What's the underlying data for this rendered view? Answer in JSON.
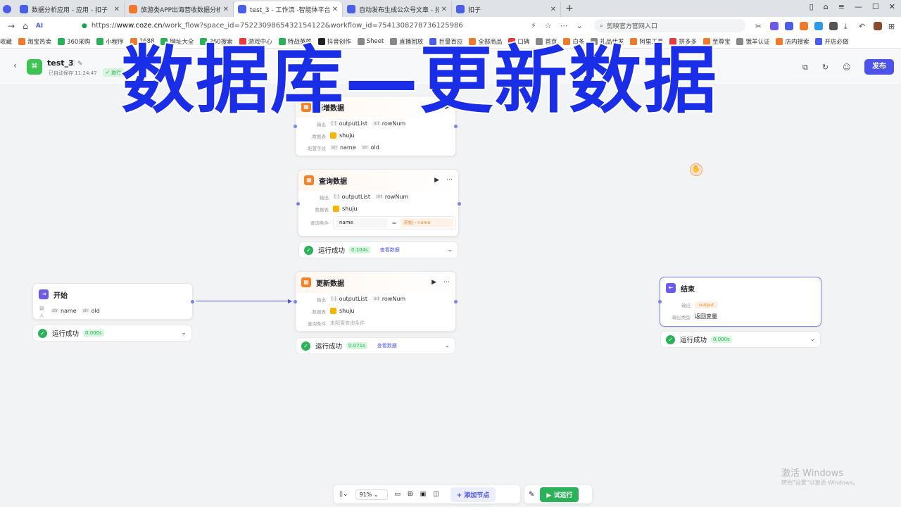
{
  "browser": {
    "tabs": [
      {
        "label": "数据分析应用 - 应用 - 扣子",
        "color": "#4a5ee8"
      },
      {
        "label": "旅游类APP出海营收数据分析报告",
        "color": "#f07a2b"
      },
      {
        "label": "test_3 - 工作流 -智能体平台",
        "color": "#4a5ee8",
        "active": true
      },
      {
        "label": "自动发布生成公众号文章 - 扣",
        "color": "#4a5ee8"
      },
      {
        "label": "扣子",
        "color": "#4a5ee8"
      }
    ],
    "new_tab": "+",
    "url_prefix": "https://",
    "url_host": "www.coze.cn",
    "url_path": "/work_flow?space_id=7522309865432154122&workflow_id=7541308278736125986",
    "search_placeholder": "剪映官方官网入口",
    "bookmarks": [
      {
        "label": "收藏",
        "color": ""
      },
      {
        "label": "淘宝热卖",
        "color": "#f07a2b"
      },
      {
        "label": "360采购",
        "color": "#2bb15a"
      },
      {
        "label": "小程序",
        "color": "#2bb15a"
      },
      {
        "label": "1688",
        "color": "#f07a2b"
      },
      {
        "label": "网址大全",
        "color": "#2bb15a"
      },
      {
        "label": "360搜索",
        "color": "#2bb15a"
      },
      {
        "label": "游戏中心",
        "color": "#e83a3a"
      },
      {
        "label": "特战英雄",
        "color": "#2bb15a"
      },
      {
        "label": "抖音创作",
        "color": "#222222"
      },
      {
        "label": "Sheet",
        "color": "#888888"
      },
      {
        "label": "直播回放",
        "color": "#888888"
      },
      {
        "label": "巨量百应",
        "color": "#4a5ee8"
      },
      {
        "label": "全部商品",
        "color": "#f07a2b"
      },
      {
        "label": "口碑",
        "color": "#e83a3a"
      },
      {
        "label": "首页",
        "color": "#888888"
      },
      {
        "label": "白条",
        "color": "#f07a2b"
      },
      {
        "label": "礼品代发",
        "color": "#888888"
      },
      {
        "label": "阿里工具",
        "color": "#f07a2b"
      },
      {
        "label": "拼多多",
        "color": "#e83a3a"
      },
      {
        "label": "至尊宝",
        "color": "#f07a2b"
      },
      {
        "label": "饿羊认证",
        "color": "#888888"
      },
      {
        "label": "店内搜索",
        "color": "#f07a2b"
      },
      {
        "label": "开店必做",
        "color": "#4a5ee8"
      }
    ]
  },
  "header": {
    "back": "‹",
    "app_name": "test_3",
    "app_icons": "ⓘ ✎",
    "autosave": "已自动保存 11:24:47",
    "run_badge": "✓ 运行",
    "publish_label": "发布"
  },
  "overlay_title": "数据库—更新数据",
  "nodes": {
    "top_db": {
      "title": "新增数据",
      "output_label": "输出",
      "outputs": [
        "outputList",
        "rowNum"
      ],
      "output_types": [
        "[·]",
        "int"
      ],
      "table_label": "数据表",
      "table": "shuju",
      "fields_label": "配置字段",
      "fields": [
        "name",
        "old"
      ],
      "field_types": [
        "str",
        "str"
      ]
    },
    "query": {
      "title": "查询数据",
      "output_label": "输出",
      "outputs": [
        "outputList",
        "rowNum"
      ],
      "output_types": [
        "[·]",
        "int"
      ],
      "table_label": "数据表",
      "table": "shuju",
      "cond_label": "查询条件",
      "cond_field": "name",
      "cond_op": "=",
      "cond_value": "开始 › name",
      "status": "运行成功",
      "time": "0.104s",
      "view": "查看数据"
    },
    "update": {
      "title": "更新数据",
      "output_label": "输出",
      "outputs": [
        "outputList",
        "rowNum"
      ],
      "output_types": [
        "[·]",
        "int"
      ],
      "table_label": "数据表",
      "table": "shuju",
      "cond_label": "查询条件",
      "cond_value": "未配置查询条件",
      "status": "运行成功",
      "time": "0.071s",
      "view": "查看数据"
    },
    "start": {
      "title": "开始",
      "input_label": "输入",
      "inputs": [
        "name",
        "old"
      ],
      "input_types": [
        "str",
        "str"
      ],
      "status": "运行成功",
      "time": "0.000s"
    },
    "end": {
      "title": "结束",
      "output_label": "输出",
      "output_value": "output",
      "type_label": "输出类型",
      "type_value": "返回变量",
      "status": "运行成功",
      "time": "0.000s"
    }
  },
  "toolbar": {
    "zoom": "91%",
    "add_node": "+ 添加节点",
    "test_run": "▶ 试运行"
  },
  "watermark": {
    "line1": "激活 Windows",
    "line2": "转到\"设置\"以激活 Windows。"
  },
  "colors": {
    "accent": "#4d53e8",
    "success": "#2bb15a",
    "db_orange": "#f0832b",
    "overlay_blue": "#1a2ee8"
  }
}
